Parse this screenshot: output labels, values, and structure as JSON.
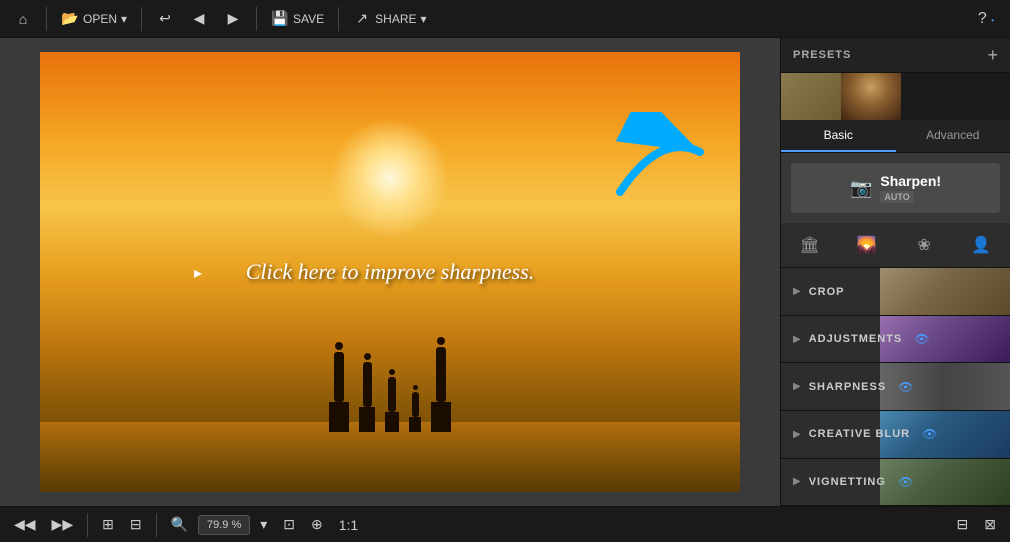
{
  "toolbar": {
    "home_label": "⌂",
    "open_label": "OPEN",
    "open_dropdown": "▾",
    "undo_icon": "↩",
    "redo_icons": [
      "◀",
      "▶"
    ],
    "save_label": "SAVE",
    "share_label": "SHARE",
    "share_dropdown": "▾",
    "help_label": "?"
  },
  "image_overlay_text": "Click here to improve sharpness.",
  "right_panel": {
    "presets_label": "PRESETS",
    "add_label": "+",
    "tabs": [
      "Basic",
      "Advanced"
    ],
    "active_tab": "Basic",
    "sharpen_label": "Sharpen!",
    "sharpen_auto": "AUTO",
    "tool_icons": [
      "🏛",
      "🌄",
      "🌸",
      "👤"
    ],
    "sections": [
      {
        "label": "CROP",
        "has_eye": false
      },
      {
        "label": "ADJUSTMENTS",
        "has_eye": true
      },
      {
        "label": "SHARPNESS",
        "has_eye": true
      },
      {
        "label": "CREATIVE BLUR",
        "has_eye": true
      },
      {
        "label": "VIGNETTING",
        "has_eye": true
      }
    ]
  },
  "bottom_toolbar": {
    "zoom_value": "79.9 %",
    "icons": [
      "◀◀",
      "▶▶",
      "⊞",
      "⊟",
      "⊡"
    ]
  },
  "status_bar": {
    "left_icons": [
      "⊟",
      "⊞"
    ],
    "right_icons": [
      "⊡",
      "⊠"
    ]
  }
}
